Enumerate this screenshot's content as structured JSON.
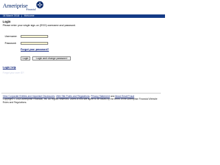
{
  "brand": {
    "name": "Ameriprise",
    "tagline": "Financial"
  },
  "topbar": {
    "date": "16 March 2018",
    "separator": "|",
    "section": "Welcome"
  },
  "login": {
    "heading": "Login",
    "instructions": "Please enter your single sign-on (SSO) username and password.",
    "username_label": "Username:",
    "username_value": "",
    "password_label": "Password:",
    "password_value": "",
    "forgot_password": "Forgot your password?",
    "login_button": "Login",
    "login_change_button": "Login and change password"
  },
  "help": {
    "login_help": "Login help",
    "forgot_id": "Forgot your user ID?"
  },
  "footer": {
    "link_disclosures": "View Corporate Entities and Important Disclosures",
    "sep1": ".",
    "link_rules": "Web Site Rules and Regulations",
    "sep2": ".",
    "link_privacy": "Privacy Statement",
    "and": "and",
    "link_fraud": "About Email Fraud",
    "copyright": "Copyright © 2018 Ameriprise Financial, Inc. All Rights Reserved. Users of this site agree to be bound by the terms of the Ameriprise Financial Website Rules and Regulations."
  }
}
